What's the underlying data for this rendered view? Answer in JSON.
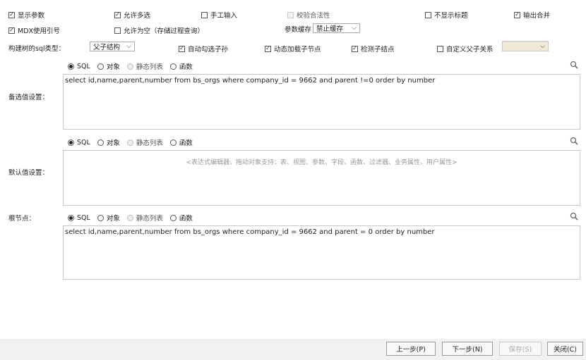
{
  "row1": {
    "show_params": {
      "label": "显示参数",
      "checked": true
    },
    "allow_multi": {
      "label": "允许多选",
      "checked": true
    },
    "manual_input": {
      "label": "手工输入",
      "checked": false
    },
    "validate": {
      "label": "校验合法性",
      "checked": false,
      "disabled": true
    },
    "hide_title": {
      "label": "不显示标题",
      "checked": false
    },
    "output_merge": {
      "label": "输出合并",
      "checked": true
    }
  },
  "row2": {
    "mdx_quote": {
      "label": "MDX使用引号",
      "checked": true
    },
    "allow_empty": {
      "label": "允许为空（存储过程查询）",
      "checked": false
    },
    "param_cache_label": "参数缓存",
    "param_cache_value": "禁止缓存"
  },
  "row3": {
    "tree_sql_type_label": "构建树的sql类型：",
    "tree_sql_type_value": "父子结构",
    "auto_check_children": {
      "label": "自动勾选子孙",
      "checked": true
    },
    "dynamic_load": {
      "label": "动态加载子节点",
      "checked": true
    },
    "detect_child": {
      "label": "检测子结点",
      "checked": true
    },
    "custom_relation": {
      "label": "自定义父子关系",
      "checked": false
    }
  },
  "source_options": {
    "sql": "SQL",
    "object": "对象",
    "static_list": "静态列表",
    "function": "函数"
  },
  "candidate": {
    "label": "备选值设置：",
    "text": "select id,name,parent,number from bs_orgs where company_id = 9662 and parent !=0 order by number"
  },
  "default_value": {
    "label": "默认值设置：",
    "placeholder": "<表达式编辑器，拖动对象支持：表、视图、参数、字段、函数、过滤器、业务属性、用户属性>"
  },
  "root_node": {
    "label": "根节点：",
    "text": "select id,name,parent,number from bs_orgs where company_id = 9662 and parent = 0 order by number"
  },
  "footer": {
    "prev": "上一步(P)",
    "next": "下一步(N)",
    "save": "保存(S)",
    "close": "关闭(C)"
  },
  "icons": {
    "check": "✓",
    "chevron": "⌵"
  }
}
